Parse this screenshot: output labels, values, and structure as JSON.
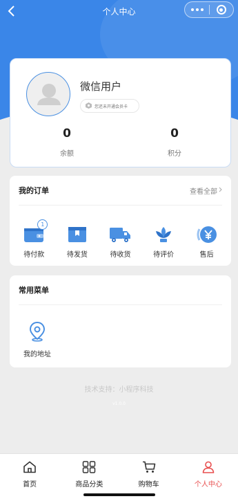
{
  "navbar": {
    "title": "个人中心"
  },
  "profile": {
    "username": "微信用户",
    "member_status": "您还未开通会员卡",
    "balance_value": "0",
    "balance_label": "余额",
    "points_value": "0",
    "points_label": "积分"
  },
  "orders": {
    "title": "我的订单",
    "view_all": "查看全部",
    "items": [
      {
        "label": "待付款",
        "icon": "wallet-icon",
        "badge": "1"
      },
      {
        "label": "待发货",
        "icon": "package-icon"
      },
      {
        "label": "待收货",
        "icon": "truck-icon"
      },
      {
        "label": "待评价",
        "icon": "lotus-icon"
      },
      {
        "label": "售后",
        "icon": "yen-icon"
      }
    ]
  },
  "menu": {
    "title": "常用菜单",
    "items": [
      {
        "label": "我的地址",
        "icon": "location-pin-icon"
      }
    ]
  },
  "footer": {
    "support": "技术支持：小程序科技",
    "version": "v1.0.0"
  },
  "tabbar": {
    "items": [
      {
        "label": "首页",
        "icon": "home-icon"
      },
      {
        "label": "商品分类",
        "icon": "grid-icon"
      },
      {
        "label": "购物车",
        "icon": "cart-icon"
      },
      {
        "label": "个人中心",
        "icon": "user-icon",
        "active": true
      }
    ]
  },
  "colors": {
    "brand_blue": "#3a86e8",
    "icon_blue": "#4a90e2",
    "active_red": "#e84e4e",
    "background": "#ededed"
  }
}
